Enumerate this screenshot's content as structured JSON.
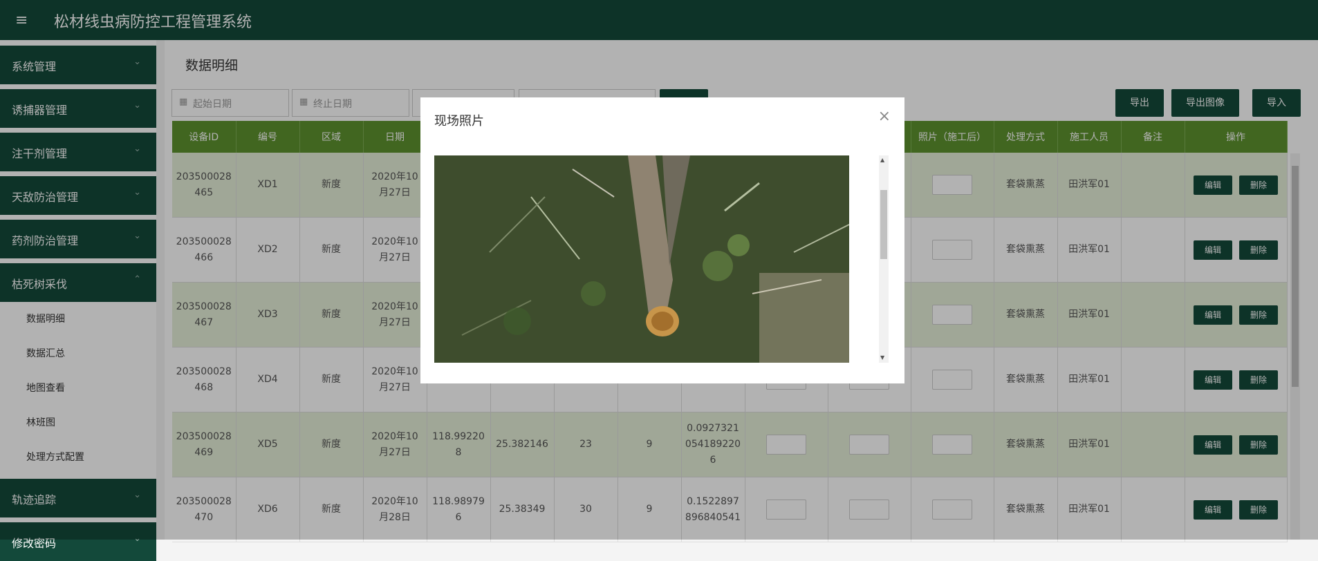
{
  "app": {
    "title": "松材线虫病防控工程管理系统",
    "menu_icon": "hamburger-icon"
  },
  "sidebar": {
    "groups": [
      {
        "label": "系统管理"
      },
      {
        "label": "诱捕器管理"
      },
      {
        "label": "注干剂管理"
      },
      {
        "label": "天敌防治管理"
      },
      {
        "label": "药剂防治管理"
      },
      {
        "label": "枯死树采伐"
      },
      {
        "label": "轨迹追踪"
      },
      {
        "label": "修改密码"
      }
    ],
    "sub_items": [
      {
        "label": "数据明细"
      },
      {
        "label": "数据汇总"
      },
      {
        "label": "地图查看"
      },
      {
        "label": "林班图"
      },
      {
        "label": "处理方式配置"
      }
    ]
  },
  "page": {
    "title": "数据明细"
  },
  "filters": {
    "start_date": "起始日期",
    "end_date": "终止日期"
  },
  "actions": {
    "export": "导出",
    "export_image": "导出图像",
    "import": "导入"
  },
  "table": {
    "headers": [
      "设备ID",
      "编号",
      "区域",
      "日期",
      "",
      "",
      "",
      "",
      "",
      "",
      "",
      "照片（施工后）",
      "处理方式",
      "施工人员",
      "备注",
      "操作"
    ],
    "rows": [
      {
        "id": "203500028\n465",
        "code": "XD1",
        "region": "新度",
        "date": "2020年10\n月27日",
        "lng": "",
        "lat": "",
        "a": "",
        "b": "",
        "c": "",
        "method": "套袋熏蒸",
        "worker": "田洪军01"
      },
      {
        "id": "203500028\n466",
        "code": "XD2",
        "region": "新度",
        "date": "2020年10\n月27日",
        "lng": "",
        "lat": "",
        "a": "",
        "b": "",
        "c": "",
        "method": "套袋熏蒸",
        "worker": "田洪军01"
      },
      {
        "id": "203500028\n467",
        "code": "XD3",
        "region": "新度",
        "date": "2020年10\n月27日",
        "lng": "",
        "lat": "",
        "a": "",
        "b": "",
        "c": "",
        "method": "套袋熏蒸",
        "worker": "田洪军01"
      },
      {
        "id": "203500028\n468",
        "code": "XD4",
        "region": "新度",
        "date": "2020年10\n月27日",
        "lng": "",
        "lat": "",
        "a": "",
        "b": "",
        "c": "",
        "method": "套袋熏蒸",
        "worker": "田洪军01"
      },
      {
        "id": "203500028\n469",
        "code": "XD5",
        "region": "新度",
        "date": "2020年10\n月27日",
        "lng": "118.99220\n8",
        "lat": "25.382146",
        "a": "23",
        "b": "9",
        "c": "0.0927321\n054189220\n6",
        "method": "套袋熏蒸",
        "worker": "田洪军01"
      },
      {
        "id": "203500028\n470",
        "code": "XD6",
        "region": "新度",
        "date": "2020年10\n月28日",
        "lng": "118.98979\n6",
        "lat": "25.38349",
        "a": "30",
        "b": "9",
        "c": "0.1522897\n896840541",
        "method": "套袋熏蒸",
        "worker": "田洪军01"
      }
    ],
    "edit_label": "编辑",
    "delete_label": "删除"
  },
  "modal": {
    "title": "现场照片",
    "close": "×"
  },
  "colors": {
    "header_bg": "#13493a",
    "table_header": "#5d922e",
    "row_alt": "#e6efd9"
  }
}
